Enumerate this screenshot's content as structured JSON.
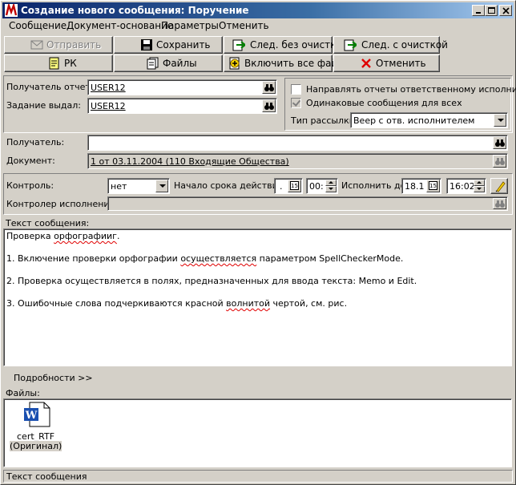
{
  "window": {
    "title": "Создание нового сообщения: Поручение"
  },
  "menu": [
    "Сообщение",
    "Документ-основание",
    "Параметры",
    "Отменить"
  ],
  "toolbar": {
    "send": "Отправить",
    "save": "Сохранить",
    "next_no_clear": "След. без очистки",
    "next_clear": "След. с очисткой",
    "rk": "РК",
    "files": "Файлы",
    "include_all": "Включить все файлы",
    "cancel": "Отменить"
  },
  "form": {
    "report_recipient_label": "Получатель отчета:",
    "report_recipient_value": "USER12",
    "issued_by_label": "Задание выдал:",
    "issued_by_value": "USER12",
    "send_reports_label": "Направлять отчеты ответственному исполнителю",
    "send_reports_checked": false,
    "same_messages_label": "Одинаковые сообщения для всех",
    "same_messages_checked": true,
    "mailing_type_label": "Тип рассылки:",
    "mailing_type_value": "Веер с отв. исполнителем",
    "recipient_label": "Получатель:",
    "recipient_value": "",
    "document_label": "Документ:",
    "document_value": "1 от 03.11.2004 (110 Входящие Общества)"
  },
  "control": {
    "control_label": "Контроль:",
    "control_value": "нет",
    "start_label": "Начало срока действия:",
    "start_date": ".",
    "start_time": "00:",
    "due_label": "Исполнить до:",
    "due_date": "18.1",
    "due_time": "16:02",
    "controller_label": "Контролер исполнения:",
    "controller_value": "",
    "calendar_glyph": "15"
  },
  "message": {
    "label": "Текст сообщения:",
    "lines": [
      {
        "pre": "Проверка ",
        "err": "орфографииг",
        "post": "."
      },
      {
        "pre": "1. Включение проверки орфографии ",
        "err": "осуществляется",
        "post": " параметром SpellCheckerMode."
      },
      {
        "pre": "2. Проверка осуществляется в полях, предназначенных для ввода текста: Memo и Edit.",
        "err": "",
        "post": ""
      },
      {
        "pre": "3. Ошибочные слова подчеркиваются красной ",
        "err": "волнитой",
        "post": " чертой, см. рис."
      }
    ]
  },
  "details": {
    "label": "Подробности >>"
  },
  "files": {
    "label": "Файлы:",
    "items": [
      {
        "name": "cert_RTF",
        "note": "(Оригинал)",
        "icon": "word-document-icon"
      }
    ]
  },
  "status": {
    "text": "Текст сообщения"
  },
  "colors": {
    "titlebar_start": "#0a246a",
    "titlebar_end": "#a6caf0",
    "face": "#d4d0c8",
    "spell_error": "#e00000",
    "cancel_x": "#e00000"
  }
}
